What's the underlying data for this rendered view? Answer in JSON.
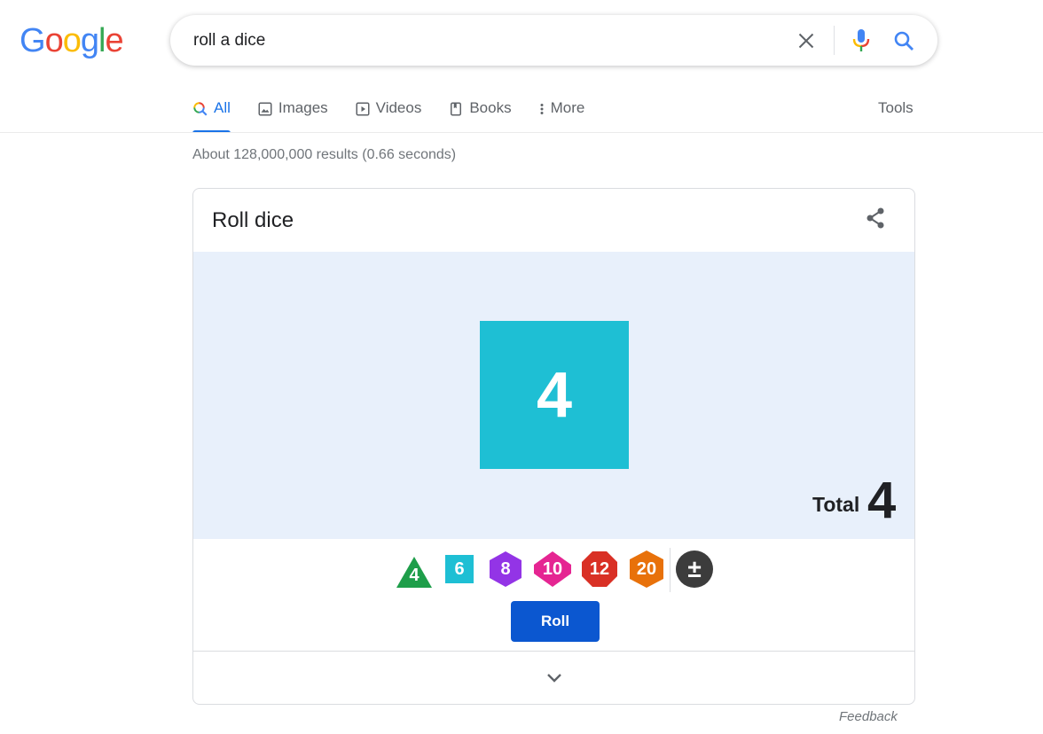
{
  "logo": {
    "letters": [
      "G",
      "o",
      "o",
      "g",
      "l",
      "e"
    ],
    "colors": [
      "#4285F4",
      "#EA4335",
      "#FBBC05",
      "#4285F4",
      "#34A853",
      "#EA4335"
    ]
  },
  "search": {
    "query": "roll a dice",
    "icons": [
      "close-icon",
      "mic-icon",
      "search-icon"
    ]
  },
  "tabs": [
    {
      "label": "All",
      "icon": "search-multicolor-icon",
      "active": true
    },
    {
      "label": "Images",
      "icon": "image-icon",
      "active": false
    },
    {
      "label": "Videos",
      "icon": "play-icon",
      "active": false
    },
    {
      "label": "Books",
      "icon": "book-icon",
      "active": false
    },
    {
      "label": "More",
      "icon": "more-vert-icon",
      "active": false
    }
  ],
  "tools_label": "Tools",
  "result_stats": "About 128,000,000 results (0.66 seconds)",
  "card": {
    "title": "Roll dice",
    "share_icon": "share-icon",
    "rolled_die": {
      "sides": 6,
      "value": "4",
      "color": "#1EBFD4"
    },
    "total_label": "Total",
    "total_value": "4",
    "dice_options": [
      {
        "label": "4",
        "shape": "triangle",
        "color": "#1E9E4A"
      },
      {
        "label": "6",
        "shape": "square",
        "color": "#1EBFD4"
      },
      {
        "label": "8",
        "shape": "hexagon",
        "color": "#9334E6"
      },
      {
        "label": "10",
        "shape": "rhombus",
        "color": "#E52592"
      },
      {
        "label": "12",
        "shape": "octagon",
        "color": "#D93025"
      },
      {
        "label": "20",
        "shape": "hexagon",
        "color": "#E8710A"
      },
      {
        "label": "±",
        "shape": "circle",
        "color": "#3C3C3C"
      }
    ],
    "roll_label": "Roll",
    "expand_icon": "chevron-down-icon"
  },
  "feedback_label": "Feedback",
  "accent_color": "#1A73E8",
  "roll_button_color": "#0B57D0"
}
